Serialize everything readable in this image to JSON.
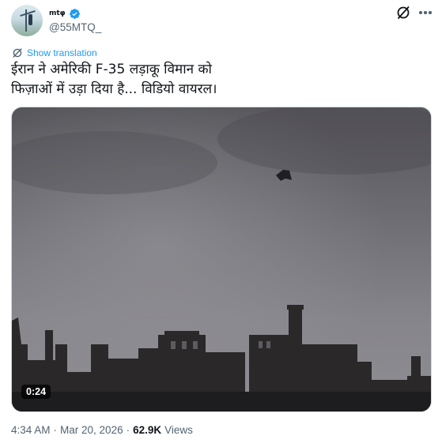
{
  "tweet": {
    "display_name": "mtφ",
    "handle": "@55MTQ_",
    "verified": true,
    "show_translation_label": "Show translation",
    "text_line1": "ईरान ने अमेरिकी F-35 लड़ाकू विमान को",
    "text_line2": "फिज़ाओं में उड़ा दिया है... विडियो वायरल।",
    "video_duration": "0:24",
    "time": "4:34 AM",
    "separator": "·",
    "date": "Mar 20, 2026",
    "views_count": "62.9K",
    "views_label": "Views"
  },
  "colors": {
    "link": "#1d9bf0",
    "verified_badge": "#1d9bf0",
    "secondary_text": "#536471",
    "primary_text": "#0f1419"
  },
  "icons": [
    "grok-icon",
    "more-options-icon",
    "translate-icon",
    "verified-badge-icon",
    "avatar"
  ]
}
